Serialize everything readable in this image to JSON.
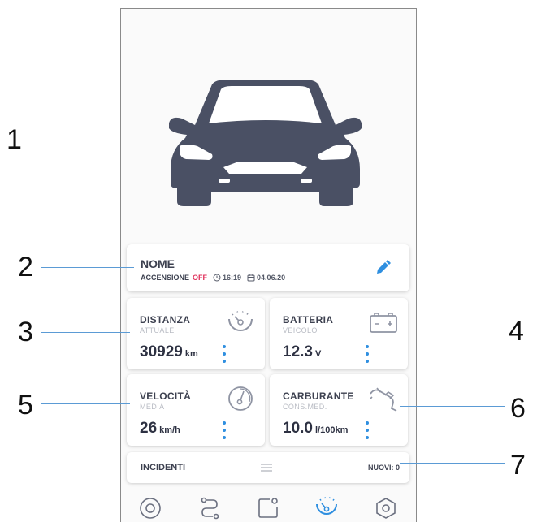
{
  "profile": {
    "name": "NOME",
    "ignition_label": "ACCENSIONE",
    "ignition_state": "OFF",
    "time": "16:19",
    "date": "04.06.20"
  },
  "stats": {
    "distance": {
      "title": "DISTANZA",
      "subtitle": "ATTUALE",
      "value": "30929",
      "unit": "km"
    },
    "battery": {
      "title": "BATTERIA",
      "subtitle": "VEICOLO",
      "value": "12.3",
      "unit": "V"
    },
    "speed": {
      "title": "VELOCITÀ",
      "subtitle": "MEDIA",
      "value": "26",
      "unit": "km/h"
    },
    "fuel": {
      "title": "CARBURANTE",
      "subtitle": "CONS.MED.",
      "value": "10.0",
      "unit": "l/100km"
    }
  },
  "incidents": {
    "title": "INCIDENTI",
    "new_label": "NUOVI: 0"
  },
  "callouts": [
    "1",
    "2",
    "3",
    "4",
    "5",
    "6",
    "7"
  ],
  "icons": {
    "car": "car-front-icon",
    "edit": "pencil-icon",
    "distance": "speedometer-icon",
    "battery": "battery-icon",
    "speed": "gauge-icon",
    "fuel": "fuel-nozzle-icon",
    "menu": "hamburger-icon",
    "nav": [
      "target-icon",
      "route-icon",
      "device-icon",
      "dashboard-icon",
      "settings-hex-icon"
    ]
  },
  "colors": {
    "accent": "#2f8fe0",
    "off": "#e0325c",
    "dark": "#3d4150",
    "callout_line": "#5b9bd5"
  }
}
